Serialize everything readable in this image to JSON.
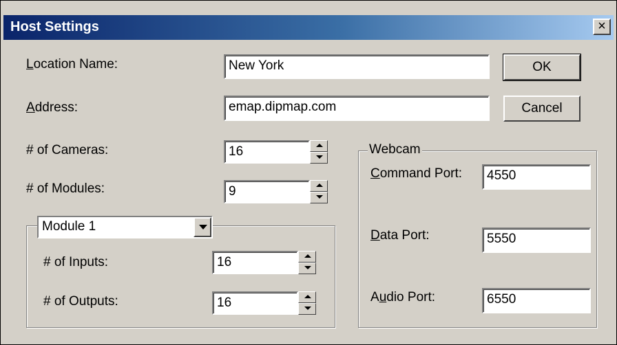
{
  "dialog": {
    "title": "Host Settings",
    "close_label": "×"
  },
  "location": {
    "label_key": "L",
    "label_rest": "ocation Name:",
    "value": "New York"
  },
  "address": {
    "label_key": "A",
    "label_rest": "ddress:",
    "value": "emap.dipmap.com"
  },
  "cameras": {
    "label": "# of Cameras:",
    "value": "16"
  },
  "modules": {
    "label": "# of Modules:",
    "value": "9"
  },
  "module_group": {
    "selected": "Module 1",
    "inputs": {
      "label": "# of Inputs:",
      "value": "16"
    },
    "outputs": {
      "label": "# of Outputs:",
      "value": "16"
    }
  },
  "buttons": {
    "ok": "OK",
    "cancel": "Cancel"
  },
  "webcam": {
    "title": "Webcam",
    "command": {
      "label_key": "C",
      "label_rest": "ommand Port:",
      "value": "4550"
    },
    "data": {
      "label_key": "D",
      "label_rest": "ata Port:",
      "value": "5550"
    },
    "audio": {
      "label_pre": "A",
      "label_key": "u",
      "label_rest": "dio Port:",
      "value": "6550"
    }
  }
}
